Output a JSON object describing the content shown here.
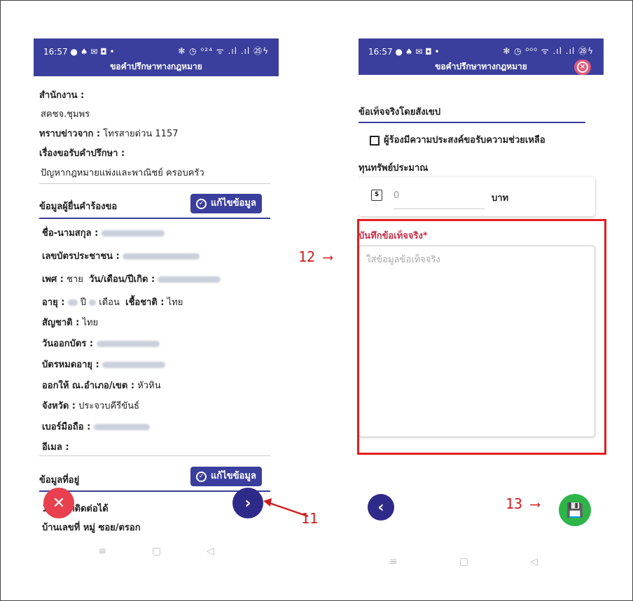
{
  "left": {
    "status": {
      "time": "16:57",
      "icons": "● ♠ ✉ ◘ •",
      "right_icons": "✻ ◷ ⁰²⁴ ᯤ .ıl .ıl ㉕ϟ"
    },
    "title": "ขอคำปรึกษาทางกฎหมาย",
    "office_label": "สำนักงาน :",
    "office_value": "สคชจ.ชุมพร",
    "source_label": "ทราบข่าวจาก :",
    "source_value": "โทรสายด่วน 1157",
    "topic_label": "เรื่องขอรับคำปรึกษา :",
    "topic_value": "ปัญหากฎหมายแพ่งและพาณิชย์ ครอบครัว",
    "applicant_section": "ข้อมูลผู้ยื่นคำร้องขอ",
    "edit_label": "แก้ไขข้อมูล",
    "name_label": "ชื่อ-นามสกุล :",
    "id_label": "เลขบัตรประชาชน :",
    "gender_label": "เพศ :",
    "gender_value": "ชาย",
    "dob_label": "วัน/เดือน/ปีเกิด :",
    "age_label": "อายุ :",
    "age_year": "ปี",
    "age_month": "เดือน",
    "race_label": "เชื้อชาติ :",
    "race_value": "ไทย",
    "nationality_label": "สัญชาติ :",
    "nationality_value": "ไทย",
    "issue_label": "วันออกบัตร :",
    "expire_label": "บัตรหมดอายุ :",
    "issued_at_label": "ออกให้ ณ.อำเภอ/เขต :",
    "issued_at_value": "หัวหิน",
    "province_label": "จังหวัด :",
    "province_value": "ประจวบคีรีขันธ์",
    "phone_label": "เบอร์มือถือ :",
    "email_label": "อีเมล :",
    "address_section": "ข้อมูลที่อยู่",
    "contact_address": "ที่อยู่ที่ติดต่อได้",
    "contact_prefix": "1.",
    "house_labels": "บ้านเลขที่  หมู่  ซอย/ตรอก",
    "close_fab": "✕",
    "next_fab": "›"
  },
  "right": {
    "status": {
      "time": "16:57",
      "icons": "● ♠ ✉ ◘ •",
      "right_icons": "✻ ◷ ⁰⁰⁰ ᯤ .ıl .ıl ㉘ϟ"
    },
    "title": "ขอคำปรึกษาทางกฎหมาย",
    "close_icon": "×",
    "facts_section": "ข้อเท็จจริงโดยสังเขป",
    "assist_checkbox": "ผู้ร้องมีความประสงค์ขอรับความช่วยเหลือ",
    "capital_label": "ทุนทรัพย์ประมาณ",
    "capital_value": "0",
    "currency": "บาท",
    "money_icon": "$",
    "facts_label": "บันทึกข้อเท็จจริง*",
    "facts_placeholder": "ใส่ข้อมูลข้อเท็จจริง",
    "back_fab": "‹",
    "save_fab": "💾"
  },
  "nav": {
    "menu": "≡",
    "home": "▢",
    "back": "◁"
  },
  "annotations": {
    "a11": "11",
    "a12": "12",
    "a13": "13"
  },
  "colors": {
    "primary": "#3a3f9d",
    "danger": "#e8404f",
    "success": "#2db54a",
    "annotation": "#e51d1d",
    "required": "#c4304a"
  }
}
